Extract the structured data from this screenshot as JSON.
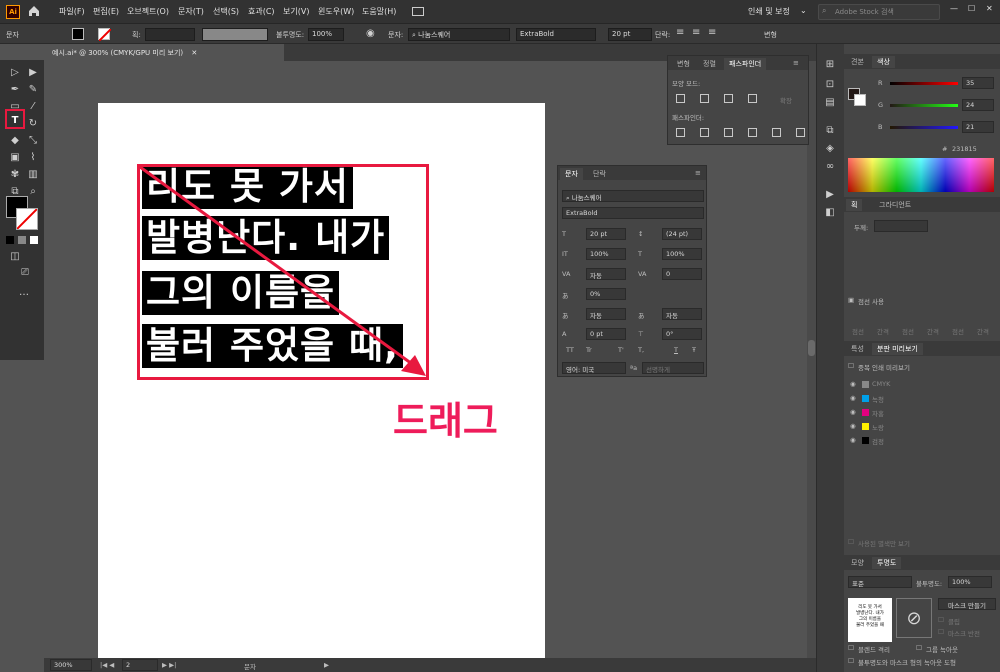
{
  "menubar": {
    "items": [
      "파일(F)",
      "편집(E)",
      "오브젝트(O)",
      "문자(T)",
      "선택(S)",
      "효과(C)",
      "보기(V)",
      "윈도우(W)",
      "도움말(H)"
    ],
    "workspace": "인쇄 및 보정",
    "search_placeholder": "Adobe Stock 검색",
    "colors": {
      "accent": "#ff9a00"
    }
  },
  "controlbar": {
    "label": "문자",
    "opacity_label": "불투명도:",
    "opacity_value": "100%",
    "char_label": "문자:",
    "font_name": "나눔스퀘어",
    "font_style": "ExtraBold",
    "font_size": "20 pt",
    "paragraph_label": "단락:",
    "transform_label": "변형"
  },
  "document": {
    "tab_title": "예시.ai* @ 300% (CMYK/GPU 미리 보기)"
  },
  "artboard": {
    "text_lines": [
      "리도 못 가서",
      "발병난다. 내가",
      "그의 이름을",
      "불러 주었을 때,"
    ],
    "annotation": "드래그",
    "colors": {
      "highlight": "#e8193f",
      "annotation": "#ee1c5a"
    }
  },
  "pathfinder_panel": {
    "tabs": [
      "변형",
      "정렬",
      "패스파인더"
    ],
    "shape_modes_label": "모양 모드:",
    "pathfinders_label": "패스파인더:",
    "expand_label": "확장"
  },
  "character_panel": {
    "tabs": [
      "문자",
      "단락"
    ],
    "font_name": "나눔스퀘어",
    "font_style": "ExtraBold",
    "size": "20 pt",
    "leading": "(24 pt)",
    "vscale": "100%",
    "hscale": "100%",
    "kerning": "자동",
    "tracking": "0",
    "tsume": "0%",
    "aki_left": "자동",
    "aki_right": "자동",
    "baseline": "0 pt",
    "rotation": "0°",
    "language": "영어: 미국",
    "antialias": "선명하게",
    "style_buttons": [
      "TT",
      "Tr",
      "T'",
      "T,",
      "T",
      "Ŧ"
    ]
  },
  "right_panels": {
    "color_tabs": [
      "견본",
      "색상"
    ],
    "r_label": "R",
    "r_value": "35",
    "g_label": "G",
    "g_value": "24",
    "b_label": "B",
    "b_value": "21",
    "hex_value": "231815",
    "stroke_tabs": [
      "획",
      "그라디언트"
    ],
    "stroke_weight_label": "두께:",
    "dashed_label": "점선 사용",
    "dash_labels": [
      "점선",
      "간격",
      "점선",
      "간격",
      "점선",
      "간격"
    ],
    "attr_tabs": [
      "특성",
      "분판 미리보기"
    ],
    "overprint_label": "중복 인쇄 미리보기",
    "separations": [
      "CMYK",
      "녹청",
      "자홍",
      "노랑",
      "검정"
    ],
    "separation_colors": [
      "#888888",
      "#00a0e9",
      "#e4007f",
      "#fff100",
      "#000000"
    ],
    "used_spots_label": "사용된 별색만 보기",
    "transparency_tabs": [
      "모양",
      "투명도"
    ],
    "blend_mode": "표준",
    "opacity_label": "불투명도:",
    "opacity_value": "100%",
    "make_mask_label": "마스크 만들기",
    "clip_label": "클립",
    "invert_mask_label": "마스크 반전",
    "isolate_label": "블렌드 격리",
    "knockout_label": "그룹 녹아웃",
    "opacity_mask_label": "불투명도와 마스크 형의 녹아웃 도형",
    "thumb_lines": [
      "리도 못 가서",
      "발병난다. 내가",
      "그의 이름을",
      "불러 주었을 때"
    ]
  },
  "status": {
    "zoom": "300%",
    "page": "2",
    "tool": "문자"
  }
}
